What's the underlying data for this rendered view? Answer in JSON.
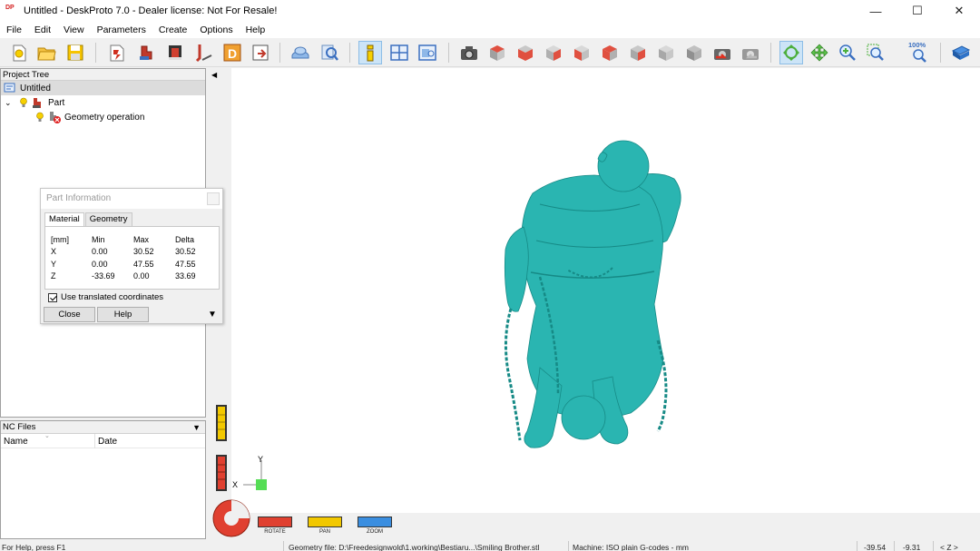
{
  "window": {
    "title": "Untitled - DeskProto 7.0 - Dealer license: Not For Resale!",
    "icon_text": "DP",
    "controls": {
      "minimize": "—",
      "maximize": "☐",
      "close": "✕"
    }
  },
  "menu": [
    "File",
    "Edit",
    "View",
    "Parameters",
    "Create",
    "Options",
    "Help"
  ],
  "toolbar": {
    "zoom_label": "100%",
    "icons": [
      "new-project-icon",
      "open-project-icon",
      "save-project-icon",
      "open-geometry-icon",
      "part-parameters-icon",
      "operation-parameters-icon",
      "vector-icon",
      "drawing-icon",
      "export-icon",
      "simulation-icon",
      "preview-icon",
      "part-info-icon",
      "layout-icon",
      "window-icon",
      "camera-icon",
      "view-top-icon",
      "view-front-icon",
      "view-right-icon",
      "view-back-icon",
      "view-left-icon",
      "view-bottom-icon",
      "view-iso-icon",
      "view-iso2-icon",
      "undo-view-icon",
      "redo-view-icon",
      "rotate-mode-icon",
      "pan-mode-icon",
      "zoom-mode-icon",
      "zoom-window-icon",
      "zoom-fit-icon",
      "help-book-icon"
    ]
  },
  "project_tree": {
    "header": "Project Tree",
    "root": "Untitled",
    "part": "Part",
    "operation": "Geometry operation"
  },
  "nc_files": {
    "header": "NC Files",
    "columns": [
      "Name",
      "Date"
    ]
  },
  "part_info": {
    "title": "Part Information",
    "tabs": [
      "Material",
      "Geometry"
    ],
    "columns": [
      "[mm]",
      "Min",
      "Max",
      "Delta"
    ],
    "rows": [
      [
        "X",
        "0.00",
        "30.52",
        "30.52"
      ],
      [
        "Y",
        "0.00",
        "47.55",
        "47.55"
      ],
      [
        "Z",
        "-33.69",
        "0.00",
        "33.69"
      ]
    ],
    "checkbox_label": "Use translated coordinates",
    "checkbox_checked": true,
    "close_button": "Close",
    "help_button": "Help"
  },
  "viewport": {
    "axis_x": "X",
    "axis_y": "Y",
    "mode_labels": [
      "ROTATE",
      "PAN",
      "ZOOM"
    ],
    "model_color": "#2ab5b1"
  },
  "statusbar": {
    "help_text": "For Help, press F1",
    "geometry_file": "Geometry file: D:\\Freedesignwold\\1.working\\Bestiaru...\\Smiling Brother.stl",
    "machine": "Machine: ISO plain G-codes - mm",
    "coord_x": "-39.54",
    "coord_y": "-9.31",
    "coord_z": "< Z >"
  }
}
